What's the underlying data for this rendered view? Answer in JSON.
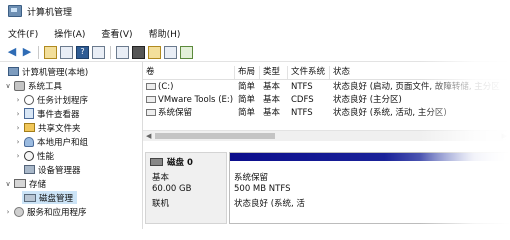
{
  "window": {
    "title": "计算机管理"
  },
  "menu": {
    "items": [
      "文件(F)",
      "操作(A)",
      "查看(V)",
      "帮助(H)"
    ]
  },
  "toolbar": {
    "icons": [
      "back-arrow-icon",
      "forward-arrow-icon",
      "folder-up-icon",
      "console-tree-icon",
      "help-icon",
      "show-hide-icon",
      "properties-icon",
      "open-icon",
      "new-icon",
      "search-icon",
      "settings-icon"
    ]
  },
  "tree": {
    "root": "计算机管理(本地)",
    "system_tools": "系统工具",
    "task_scheduler": "任务计划程序",
    "event_viewer": "事件查看器",
    "shared_folders": "共享文件夹",
    "local_users": "本地用户和组",
    "performance": "性能",
    "device_manager": "设备管理器",
    "storage": "存储",
    "disk_management": "磁盘管理",
    "services": "服务和应用程序"
  },
  "table": {
    "headers": {
      "volume": "卷",
      "layout": "布局",
      "type": "类型",
      "fs": "文件系统",
      "status": "状态"
    },
    "rows": [
      {
        "volume": "(C:)",
        "layout": "简单",
        "type": "基本",
        "fs": "NTFS",
        "status": "状态良好 (启动, 页面文件, 故障转储, 主分区"
      },
      {
        "volume": "VMware Tools (E:)",
        "layout": "简单",
        "type": "基本",
        "fs": "CDFS",
        "status": "状态良好 (主分区)"
      },
      {
        "volume": "系统保留",
        "layout": "简单",
        "type": "基本",
        "fs": "NTFS",
        "status": "状态良好 (系统, 活动, 主分区)"
      }
    ]
  },
  "disk": {
    "name": "磁盘 0",
    "type": "基本",
    "size": "60.00 GB",
    "state": "联机",
    "partition": {
      "name": "系统保留",
      "size_fs": "500 MB NTFS",
      "status": "状态良好 (系统, 活"
    }
  }
}
